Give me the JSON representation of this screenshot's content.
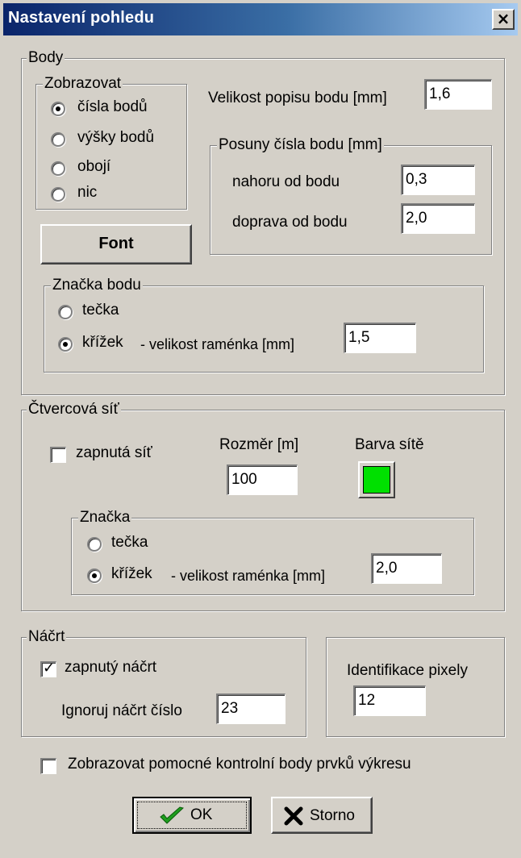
{
  "window": {
    "title": "Nastavení pohledu",
    "close_label": "×"
  },
  "body_group": {
    "title": "Body",
    "display": {
      "title": "Zobrazovat",
      "options": [
        "čísla bodů",
        "výšky bodů",
        "obojí",
        "nic"
      ],
      "selected_index": 0
    },
    "label_size_label": "Velikost popisu bodu [mm]",
    "label_size_value": "1,6",
    "offsets": {
      "title": "Posuny čísla bodu [mm]",
      "up_label": "nahoru od bodu",
      "up_value": "0,3",
      "right_label": "doprava od bodu",
      "right_value": "2,0"
    },
    "font_button": "Font",
    "marker": {
      "title": "Značka bodu",
      "option_dot": "tečka",
      "option_cross": "křížek",
      "arm_label": "- velikost raménka [mm]",
      "arm_value": "1,5",
      "selected": "cross"
    }
  },
  "grid_group": {
    "title": "Čtvercová síť",
    "enabled_label": "zapnutá síť",
    "enabled": false,
    "size_label": "Rozměr [m]",
    "size_value": "100",
    "color_label": "Barva sítě",
    "color": "#00e000",
    "marker": {
      "title": "Značka",
      "option_dot": "tečka",
      "option_cross": "křížek",
      "arm_label": "- velikost raménka [mm]",
      "arm_value": "2,0",
      "selected": "cross"
    }
  },
  "sketch_group": {
    "title": "Náčrt",
    "enabled_label": "zapnutý náčrt",
    "enabled": true,
    "ignore_label": "Ignoruj náčrt číslo",
    "ignore_value": "23"
  },
  "pixel_id": {
    "label": "Identifikace pixely",
    "value": "12"
  },
  "aux_points": {
    "label": "Zobrazovat pomocné kontrolní body prvků výkresu",
    "checked": false
  },
  "buttons": {
    "ok": "OK",
    "cancel": "Storno"
  },
  "colors": {
    "ok_check": "#1e9e1e",
    "cancel_x": "#000000",
    "title_start": "#0a246a",
    "title_end": "#a6caf0"
  }
}
